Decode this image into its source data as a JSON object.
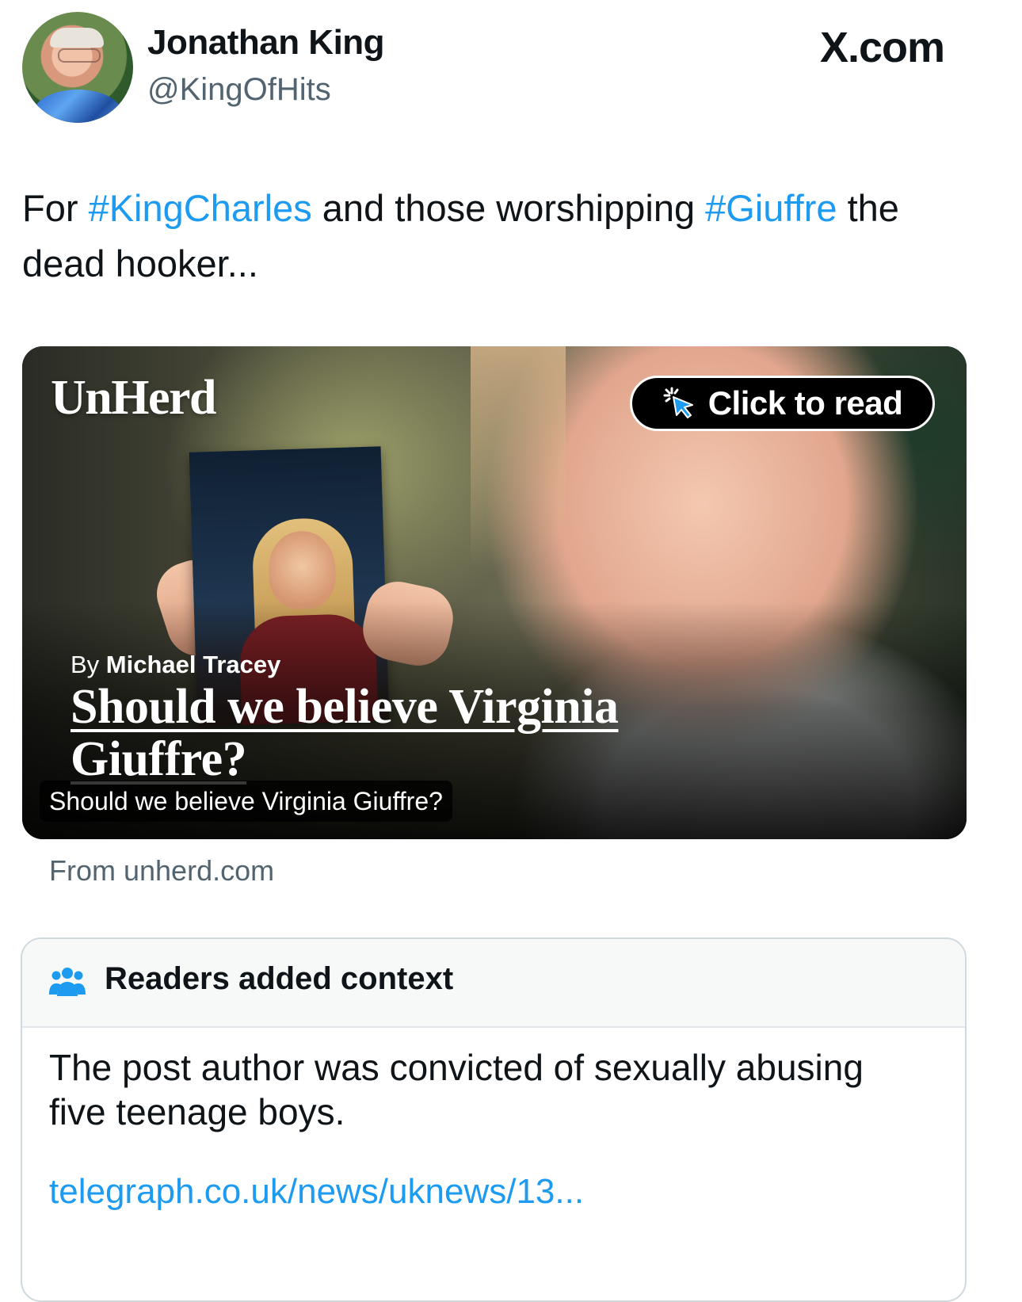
{
  "tweet": {
    "author_name": "Jonathan King",
    "author_handle": "@KingOfHits",
    "site_label": "X.com",
    "text": {
      "prefix": "For ",
      "hashtag1": "#KingCharles",
      "middle": " and those worshipping ",
      "hashtag2": "#Giuffre",
      "suffix": " the dead hooker..."
    }
  },
  "card": {
    "brand": "UnHerd",
    "cta_label": "Click to read",
    "byline_prefix": "By ",
    "byline_author": "Michael Tracey",
    "headline": "Should we believe Virginia Giuffre?",
    "caption": "Should we believe Virginia Giuffre?",
    "source": "From unherd.com"
  },
  "community_note": {
    "title": "Readers added context",
    "body": "The post author was convicted of sexually abusing five teenage boys.",
    "link": "telegraph.co.uk/news/uknews/13..."
  },
  "icons": {
    "avatar": "profile-photo",
    "cta": "cursor-pointer-icon",
    "note": "people-icon"
  },
  "colors": {
    "link_blue": "#1d9bf0",
    "secondary_text": "#536471",
    "text": "#0f1419"
  }
}
